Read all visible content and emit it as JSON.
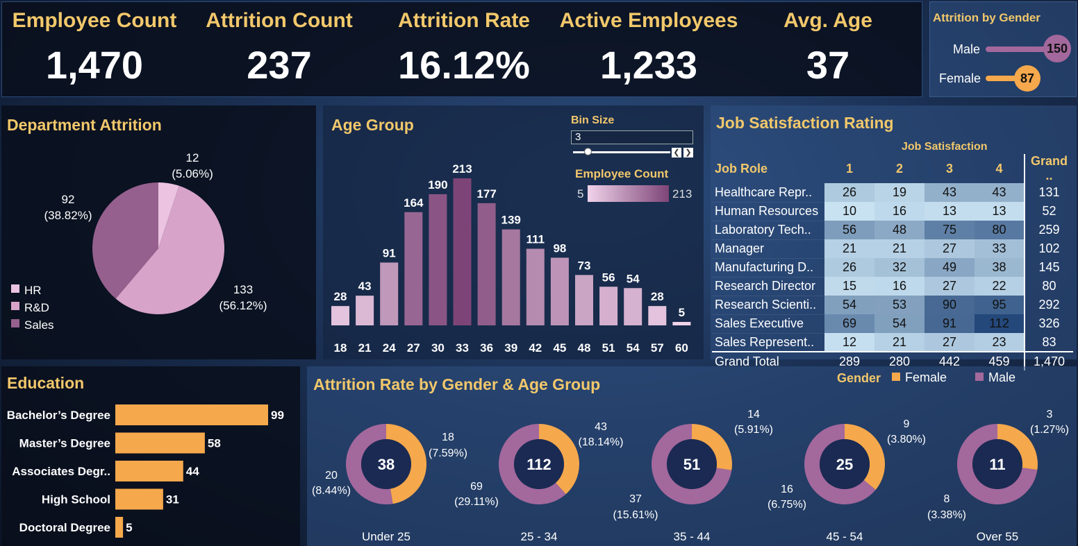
{
  "kpis": [
    {
      "label": "Employee Count",
      "value": "1,470"
    },
    {
      "label": "Attrition Count",
      "value": "237"
    },
    {
      "label": "Attrition Rate",
      "value": "16.12%"
    },
    {
      "label": "Active Employees",
      "value": "1,233"
    },
    {
      "label": "Avg. Age",
      "value": "37"
    }
  ],
  "gender_attrition": {
    "title": "Attrition by Gender",
    "rows": [
      {
        "label": "Male",
        "value": "150",
        "color": "#a3689c"
      },
      {
        "label": "Female",
        "value": "87",
        "color": "#f5a84c"
      }
    ]
  },
  "department": {
    "title": "Department Attrition",
    "legend": [
      {
        "label": "HR",
        "color": "#ecc3e1"
      },
      {
        "label": "R&D",
        "color": "#d7a3c9"
      },
      {
        "label": "Sales",
        "color": "#95608e"
      }
    ],
    "labels": {
      "hr": {
        "count": "12",
        "pct": "(5.06%)"
      },
      "rd": {
        "count": "133",
        "pct": "(56.12%)"
      },
      "sales": {
        "count": "92",
        "pct": "(38.82%)"
      }
    }
  },
  "age_group": {
    "title": "Age Group",
    "bin_size_label": "Bin Size",
    "bin_size_value": "3",
    "legend_title": "Employee Count",
    "legend_min": "5",
    "legend_max": "213"
  },
  "job_satisfaction": {
    "title": "Job Satisfaction Rating",
    "column_group": "Job Satisfaction",
    "headers": [
      "Job Role",
      "1",
      "2",
      "3",
      "4",
      "Grand .."
    ],
    "rows": [
      {
        "role": "Healthcare Repr..",
        "values": [
          "26",
          "19",
          "43",
          "43"
        ],
        "total": "131"
      },
      {
        "role": "Human Resources",
        "values": [
          "10",
          "16",
          "13",
          "13"
        ],
        "total": "52"
      },
      {
        "role": "Laboratory Tech..",
        "values": [
          "56",
          "48",
          "75",
          "80"
        ],
        "total": "259"
      },
      {
        "role": "Manager",
        "values": [
          "21",
          "21",
          "27",
          "33"
        ],
        "total": "102"
      },
      {
        "role": "Manufacturing D..",
        "values": [
          "26",
          "32",
          "49",
          "38"
        ],
        "total": "145"
      },
      {
        "role": "Research Director",
        "values": [
          "15",
          "16",
          "27",
          "22"
        ],
        "total": "80"
      },
      {
        "role": "Research Scienti..",
        "values": [
          "54",
          "53",
          "90",
          "95"
        ],
        "total": "292"
      },
      {
        "role": "Sales Executive",
        "values": [
          "69",
          "54",
          "91",
          "112"
        ],
        "total": "326"
      },
      {
        "role": "Sales Represent..",
        "values": [
          "12",
          "21",
          "27",
          "23"
        ],
        "total": "83"
      }
    ],
    "grand_total": {
      "label": "Grand Total",
      "values": [
        "289",
        "280",
        "442",
        "459"
      ],
      "total": "1,470"
    }
  },
  "education": {
    "title": "Education"
  },
  "gender_age": {
    "title": "Attrition Rate by Gender & Age Group",
    "legend_title": "Gender",
    "legend": [
      {
        "label": "Female",
        "color": "#f5a84c"
      },
      {
        "label": "Male",
        "color": "#a3689c"
      }
    ],
    "groups": [
      {
        "label": "Under 25",
        "total": "38",
        "female": "18",
        "female_pct": "(7.59%)",
        "male": "20",
        "male_pct": "(8.44%)"
      },
      {
        "label": "25 - 34",
        "total": "112",
        "female": "43",
        "female_pct": "(18.14%)",
        "male": "69",
        "male_pct": "(29.11%)"
      },
      {
        "label": "35 - 44",
        "total": "51",
        "female": "14",
        "female_pct": "(5.91%)",
        "male": "37",
        "male_pct": "(15.61%)"
      },
      {
        "label": "45 - 54",
        "total": "25",
        "female": "9",
        "female_pct": "(3.80%)",
        "male": "16",
        "male_pct": "(6.75%)"
      },
      {
        "label": "Over 55",
        "total": "11",
        "female": "3",
        "female_pct": "(1.27%)",
        "male": "8",
        "male_pct": "(3.38%)"
      }
    ]
  },
  "chart_data": [
    {
      "type": "pie",
      "title": "Department Attrition",
      "categories": [
        "HR",
        "R&D",
        "Sales"
      ],
      "values": [
        12,
        133,
        92
      ],
      "colors": [
        "#ecc3e1",
        "#d7a3c9",
        "#95608e"
      ]
    },
    {
      "type": "bar",
      "title": "Age Group",
      "categories": [
        "18",
        "21",
        "24",
        "27",
        "30",
        "33",
        "36",
        "39",
        "42",
        "45",
        "48",
        "51",
        "54",
        "57",
        "60"
      ],
      "values": [
        28,
        43,
        91,
        164,
        190,
        213,
        177,
        139,
        111,
        98,
        73,
        56,
        54,
        28,
        5
      ]
    },
    {
      "type": "bar",
      "title": "Education",
      "orientation": "horizontal",
      "categories": [
        "Bachelor’s Degree",
        "Master’s Degree",
        "Associates Degr..",
        "High School",
        "Doctoral Degree"
      ],
      "values": [
        99,
        58,
        44,
        31,
        5
      ]
    },
    {
      "type": "table",
      "title": "Job Satisfaction Rating",
      "columns": [
        "1",
        "2",
        "3",
        "4"
      ],
      "rows": [
        "Healthcare Repr..",
        "Human Resources",
        "Laboratory Tech..",
        "Manager",
        "Manufacturing D..",
        "Research Director",
        "Research Scienti..",
        "Sales Executive",
        "Sales Represent.."
      ],
      "values": [
        [
          26,
          19,
          43,
          43
        ],
        [
          10,
          16,
          13,
          13
        ],
        [
          56,
          48,
          75,
          80
        ],
        [
          21,
          21,
          27,
          33
        ],
        [
          26,
          32,
          49,
          38
        ],
        [
          15,
          16,
          27,
          22
        ],
        [
          54,
          53,
          90,
          95
        ],
        [
          69,
          54,
          91,
          112
        ],
        [
          12,
          21,
          27,
          23
        ]
      ]
    },
    {
      "type": "pie",
      "title": "Attrition Rate by Gender & Age Group",
      "categories": [
        "Under 25",
        "25 - 34",
        "35 - 44",
        "45 - 54",
        "Over 55"
      ],
      "series": [
        {
          "name": "Female",
          "values": [
            18,
            43,
            14,
            9,
            3
          ]
        },
        {
          "name": "Male",
          "values": [
            20,
            69,
            37,
            16,
            8
          ]
        }
      ]
    }
  ]
}
